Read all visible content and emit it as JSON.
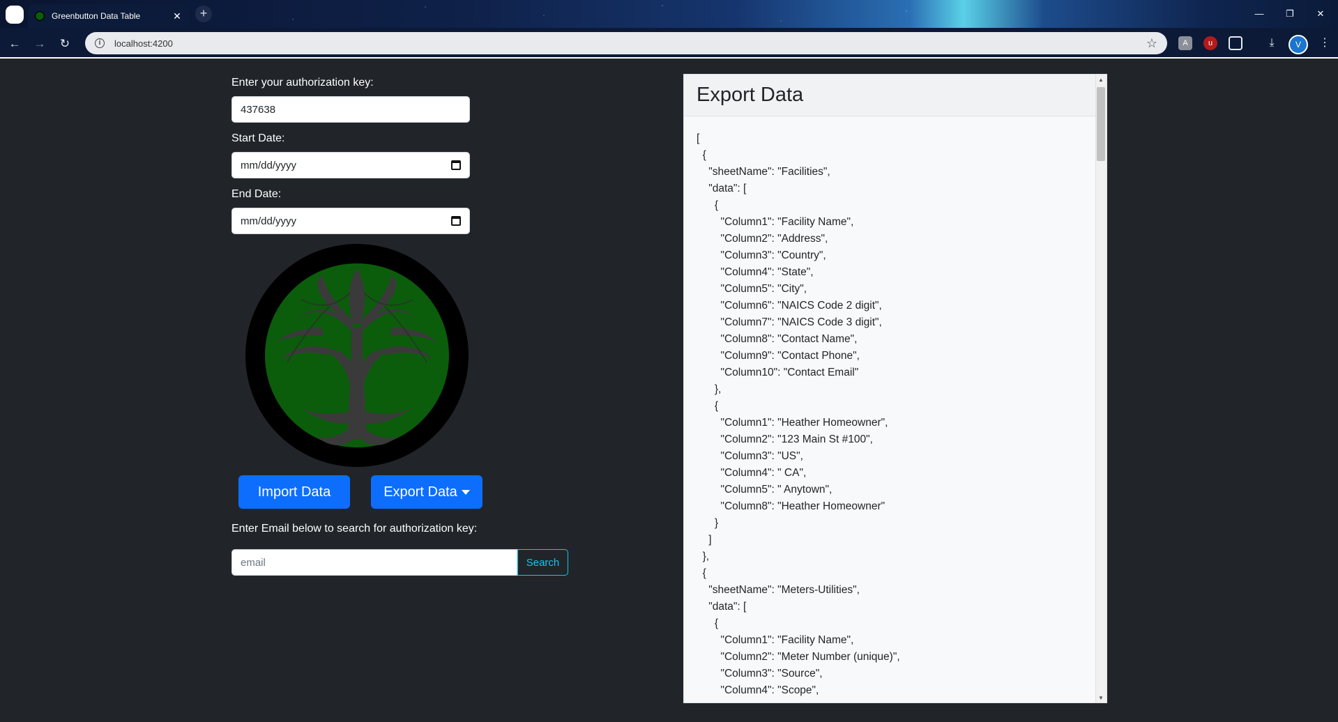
{
  "browser": {
    "tab_title": "Greenbutton Data Table",
    "tab_close": "✕",
    "new_tab": "+",
    "url": "localhost:4200",
    "avatar_letter": "V",
    "window_controls": [
      "—",
      "❐",
      "✕"
    ]
  },
  "form": {
    "auth_label": "Enter your authorization key:",
    "auth_value": "437638",
    "start_label": "Start Date:",
    "start_value": "mm/dd/yyyy",
    "end_label": "End Date:",
    "end_value": "mm/dd/yyyy",
    "import_button": "Import Data",
    "export_button": "Export Data",
    "email_label": "Enter Email below to search for authorization key:",
    "email_placeholder": "email",
    "search_button": "Search"
  },
  "export_panel": {
    "title": "Export Data",
    "json_lines": [
      "[",
      "  {",
      "    \"sheetName\": \"Facilities\",",
      "    \"data\": [",
      "      {",
      "        \"Column1\": \"Facility Name\",",
      "        \"Column2\": \"Address\",",
      "        \"Column3\": \"Country\",",
      "        \"Column4\": \"State\",",
      "        \"Column5\": \"City\",",
      "        \"Column6\": \"NAICS Code 2 digit\",",
      "        \"Column7\": \"NAICS Code 3 digit\",",
      "        \"Column8\": \"Contact Name\",",
      "        \"Column9\": \"Contact Phone\",",
      "        \"Column10\": \"Contact Email\"",
      "      },",
      "      {",
      "        \"Column1\": \"Heather Homeowner\",",
      "        \"Column2\": \"123 Main St #100\",",
      "        \"Column3\": \"US\",",
      "        \"Column4\": \" CA\",",
      "        \"Column5\": \" Anytown\",",
      "        \"Column8\": \"Heather Homeowner\"",
      "      }",
      "    ]",
      "  },",
      "  {",
      "    \"sheetName\": \"Meters-Utilities\",",
      "    \"data\": [",
      "      {",
      "        \"Column1\": \"Facility Name\",",
      "        \"Column2\": \"Meter Number (unique)\",",
      "        \"Column3\": \"Source\",",
      "        \"Column4\": \"Scope\","
    ]
  },
  "colors": {
    "page_bg": "#212529",
    "primary": "#0d6efd",
    "info": "#0dcaf0",
    "logo_green": "#0b5d0b"
  }
}
